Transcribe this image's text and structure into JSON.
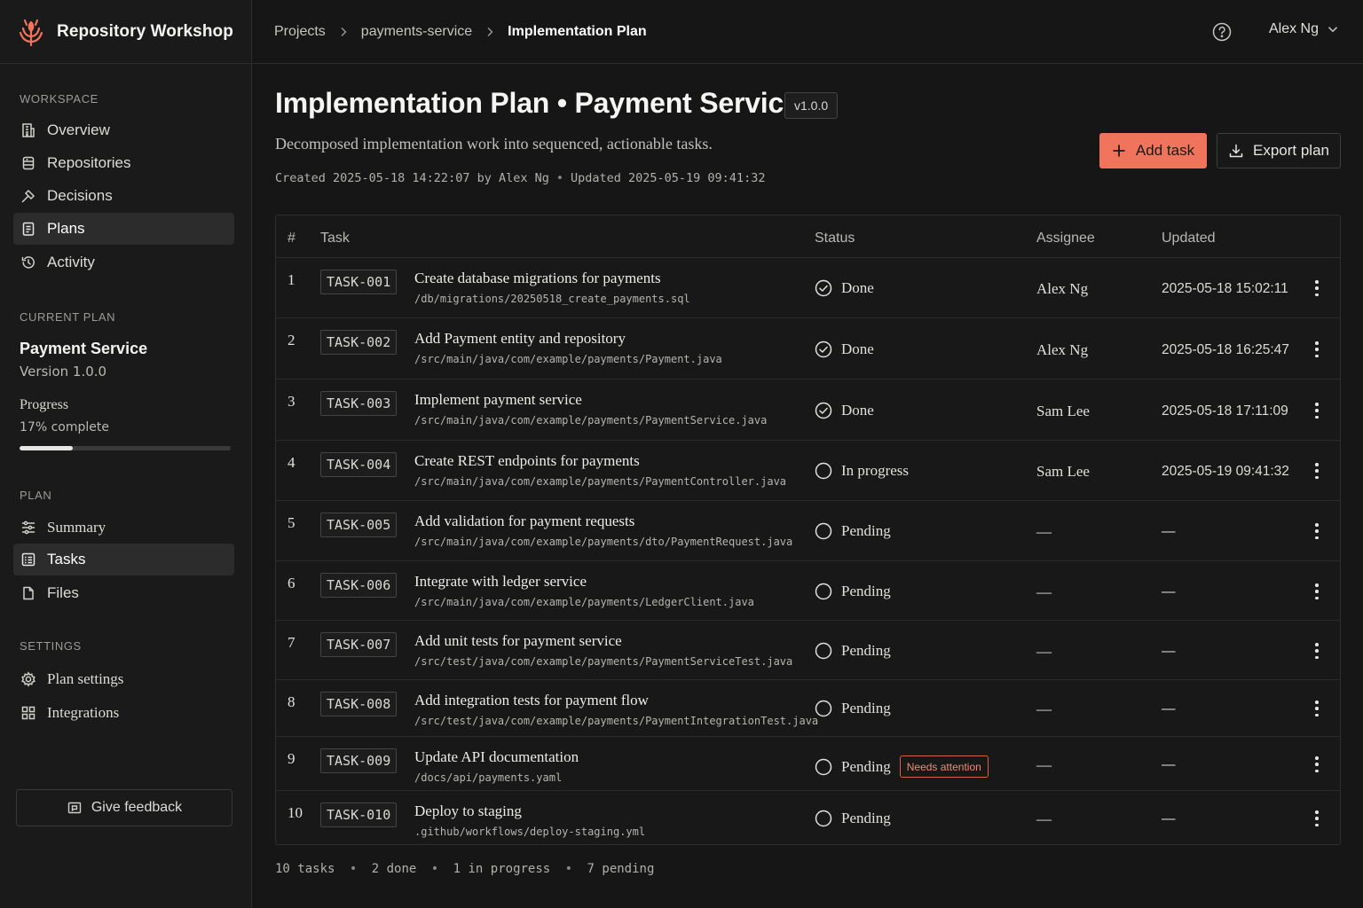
{
  "brand": {
    "name": "Repository Workshop",
    "accent": "#f0735c"
  },
  "breadcrumb": [
    "Projects",
    "payments-service",
    "Implementation Plan"
  ],
  "user": {
    "name": "Alex Ng"
  },
  "sidebar": {
    "workspace_label": "WORKSPACE",
    "workspace_items": [
      {
        "label": "Overview",
        "icon": "building-icon"
      },
      {
        "label": "Repositories",
        "icon": "database-icon"
      },
      {
        "label": "Decisions",
        "icon": "gavel-icon"
      },
      {
        "label": "Plans",
        "icon": "clipboard-icon",
        "active": true
      },
      {
        "label": "Activity",
        "icon": "history-icon"
      }
    ],
    "current_plan_label": "CURRENT PLAN",
    "plan_name": "Payment Service",
    "plan_version": "Version 1.0.0",
    "progress_label": "Progress",
    "progress_text": "17% complete",
    "progress_fraction": 0.25,
    "plan_label": "PLAN",
    "plan_items": [
      {
        "label": "Summary",
        "icon": "sliders-icon"
      },
      {
        "label": "Tasks",
        "icon": "checklist-icon",
        "active": true
      },
      {
        "label": "Files",
        "icon": "file-icon"
      }
    ],
    "settings_label": "SETTINGS",
    "settings_items": [
      {
        "label": "Plan settings",
        "icon": "gear-icon"
      },
      {
        "label": "Integrations",
        "icon": "grid-icon"
      }
    ],
    "feedback_label": "Give feedback"
  },
  "page": {
    "title": "Implementation Plan • Payment Service",
    "version_badge": "v1.0.0",
    "description": "Decomposed implementation work into sequenced, actionable tasks.",
    "created": "Created 2025-05-18 14:22:07 by Alex Ng",
    "updated": "Updated 2025-05-19 09:41:32",
    "add_task_label": "Add task",
    "export_label": "Export plan"
  },
  "table": {
    "columns": {
      "num": "#",
      "task": "Task",
      "status": "Status",
      "assignee": "Assignee",
      "updated": "Updated"
    },
    "rows": [
      {
        "num": "1",
        "id": "TASK-001",
        "title": "Create database migrations for payments",
        "path": "/db/migrations/20250518_create_payments.sql",
        "status": "Done",
        "assignee": "Alex Ng",
        "updated": "2025-05-18 15:02:11"
      },
      {
        "num": "2",
        "id": "TASK-002",
        "title": "Add Payment entity and repository",
        "path": "/src/main/java/com/example/payments/Payment.java",
        "status": "Done",
        "assignee": "Alex Ng",
        "updated": "2025-05-18 16:25:47"
      },
      {
        "num": "3",
        "id": "TASK-003",
        "title": "Implement payment service",
        "path": "/src/main/java/com/example/payments/PaymentService.java",
        "status": "Done",
        "assignee": "Sam Lee",
        "updated": "2025-05-18 17:11:09"
      },
      {
        "num": "4",
        "id": "TASK-004",
        "title": "Create REST endpoints for payments",
        "path": "/src/main/java/com/example/payments/PaymentController.java",
        "status": "In progress",
        "assignee": "Sam Lee",
        "updated": "2025-05-19 09:41:32"
      },
      {
        "num": "5",
        "id": "TASK-005",
        "title": "Add validation for payment requests",
        "path": "/src/main/java/com/example/payments/dto/PaymentRequest.java",
        "status": "Pending",
        "assignee": "—",
        "updated": "—"
      },
      {
        "num": "6",
        "id": "TASK-006",
        "title": "Integrate with ledger service",
        "path": "/src/main/java/com/example/payments/LedgerClient.java",
        "status": "Pending",
        "assignee": "—",
        "updated": "—"
      },
      {
        "num": "7",
        "id": "TASK-007",
        "title": "Add unit tests for payment service",
        "path": "/src/test/java/com/example/payments/PaymentServiceTest.java",
        "status": "Pending",
        "assignee": "—",
        "updated": "—"
      },
      {
        "num": "8",
        "id": "TASK-008",
        "title": "Add integration tests for payment flow",
        "path": "/src/test/java/com/example/payments/PaymentIntegrationTest.java",
        "status": "Pending",
        "assignee": "—",
        "updated": "—"
      },
      {
        "num": "9",
        "id": "TASK-009",
        "title": "Update API documentation",
        "path": "/docs/api/payments.yaml",
        "status": "Pending",
        "badge": "Needs attention",
        "assignee": "—",
        "updated": "—"
      },
      {
        "num": "10",
        "id": "TASK-010",
        "title": "Deploy to staging",
        "path": ".github/workflows/deploy-staging.yml",
        "status": "Pending",
        "assignee": "—",
        "updated": "—"
      }
    ]
  },
  "summary": {
    "tasks": "10 tasks",
    "done": "2 done",
    "in_progress": "1 in progress",
    "pending": "7 pending"
  }
}
